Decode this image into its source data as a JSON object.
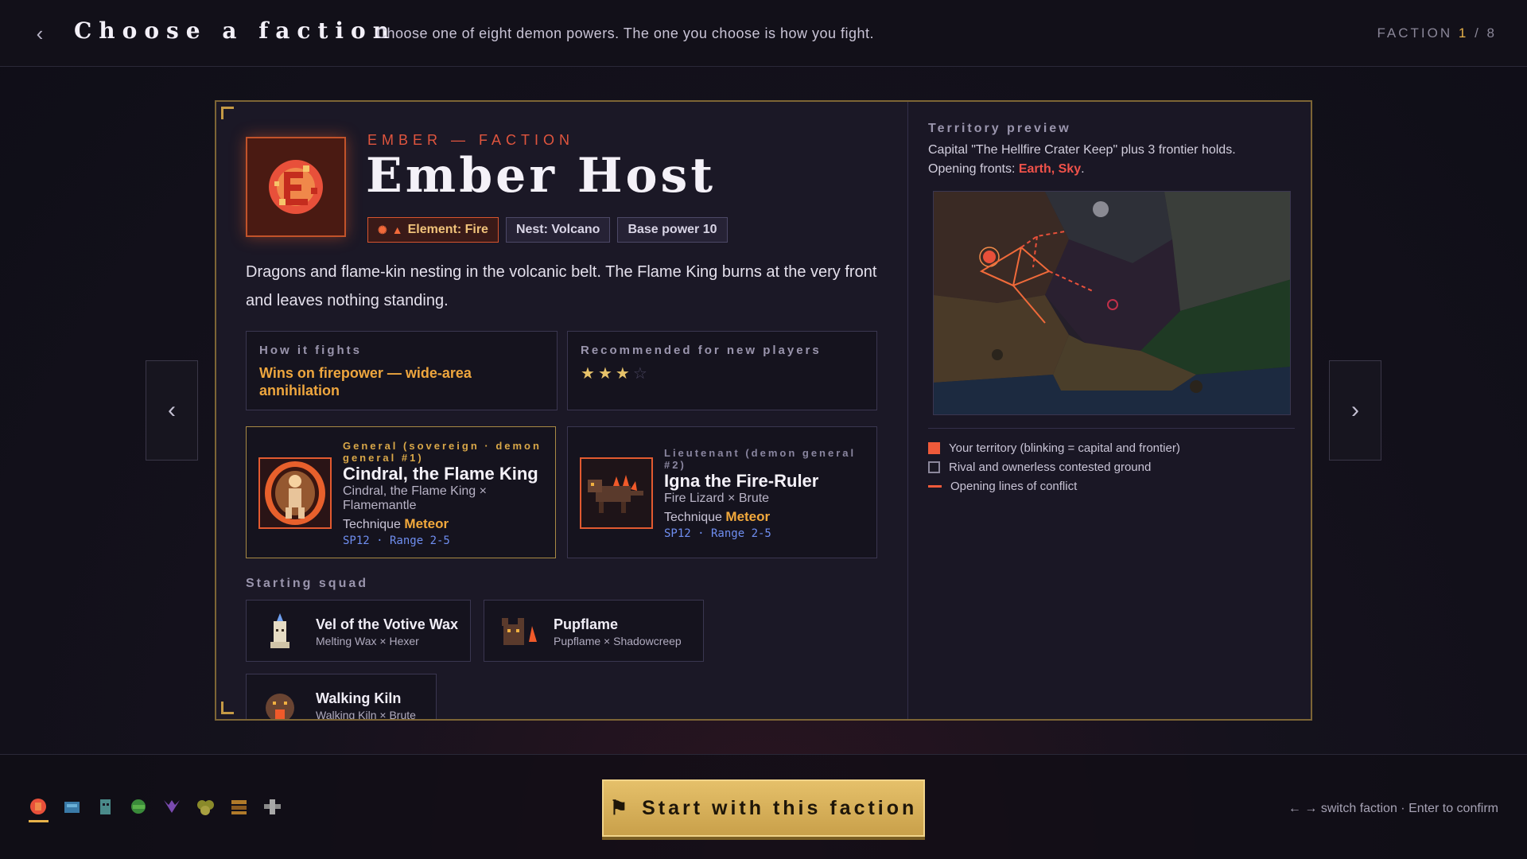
{
  "header": {
    "back_icon": "chevron-left-icon",
    "title": "Choose a faction",
    "subtitle": "Choose one of eight demon powers. The one you choose is how you fight.",
    "counter_label": "FACTION",
    "counter_current": "1",
    "counter_sep": "/",
    "counter_total": "8"
  },
  "nav": {
    "prev_icon": "chevron-left-icon",
    "next_icon": "chevron-right-icon"
  },
  "faction": {
    "kicker": "EMBER — FACTION",
    "name": "Ember Host",
    "tags": {
      "element": "Element: Fire",
      "nest": "Nest: Volcano",
      "power": "Base power 10"
    },
    "description": "Dragons and flame-kin nesting in the volcanic belt. The Flame King burns at the very front and leaves nothing standing.",
    "how_it_fights_label": "How it fights",
    "how_it_fights": "Wins on firepower — wide-area annihilation",
    "recommended_label": "Recommended for new players",
    "recommended_stars": 3,
    "recommended_max": 4
  },
  "general": {
    "role": "General (sovereign · demon general #1)",
    "name": "Cindral, the Flame King",
    "sub": "Cindral, the Flame King × Flamemantle",
    "technique_label": "Technique",
    "technique": "Meteor",
    "stats": "SP12 · Range 2-5"
  },
  "lieutenant": {
    "role": "Lieutenant (demon general #2)",
    "name": "Igna the Fire-Ruler",
    "sub": "Fire Lizard × Brute",
    "technique_label": "Technique",
    "technique": "Meteor",
    "stats": "SP12 · Range 2-5"
  },
  "squad": {
    "label": "Starting squad",
    "items": [
      {
        "name": "Vel of the Votive Wax",
        "sub": "Melting Wax × Hexer"
      },
      {
        "name": "Pupflame",
        "sub": "Pupflame × Shadowcreep"
      },
      {
        "name": "Walking Kiln",
        "sub": "Walking Kiln × Brute"
      }
    ]
  },
  "territory": {
    "label": "Territory preview",
    "capital_line": "Capital \"The Hellfire Crater Keep\" plus 3 frontier holds.",
    "fronts_prefix": "Opening fronts: ",
    "fronts": "Earth, Sky",
    "fronts_suffix": ".",
    "legend": [
      "Your territory (blinking = capital and frontier)",
      "Rival and ownerless contested ground",
      "Opening lines of conflict"
    ]
  },
  "footer": {
    "faction_icons": [
      "fire-faction-icon",
      "water-faction-icon",
      "shadow-faction-icon",
      "forest-faction-icon",
      "void-faction-icon",
      "earth-faction-icon",
      "iron-faction-icon",
      "sky-faction-icon"
    ],
    "start_label": "Start with this faction",
    "start_icon": "flag-icon",
    "hint": "← → switch faction · Enter to confirm"
  },
  "colors": {
    "accent": "#e8b24a",
    "fire": "#ef5a3a",
    "card_border": "#7d6535"
  }
}
